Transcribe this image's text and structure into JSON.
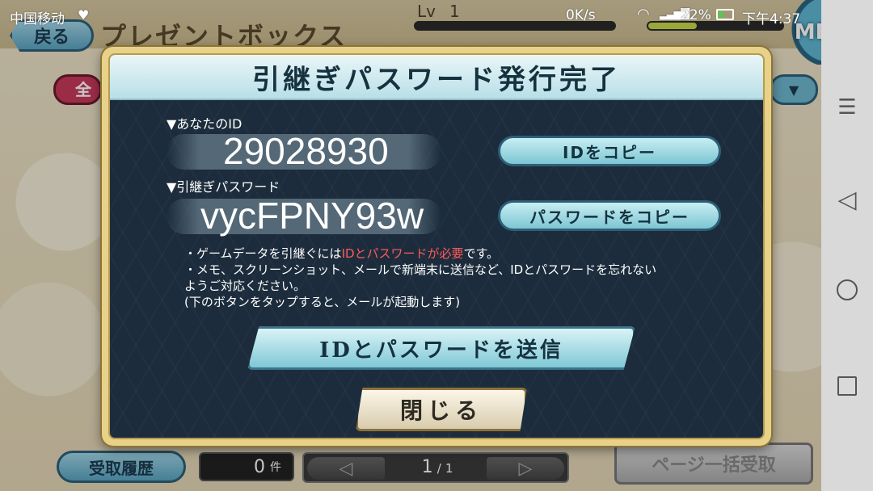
{
  "status_bar": {
    "carrier": "中国移动",
    "network_speed": "0K/s",
    "battery_percent": "22%",
    "time": "下午4:37",
    "icons": [
      "heart-icon",
      "wifi-icon",
      "signal-icon",
      "battery-icon"
    ]
  },
  "screen": {
    "back_label": "戻る",
    "title": "プレゼントボックス",
    "level_label": "Lv",
    "level_value": "1",
    "menu_label": "MENU",
    "filter_label": "全"
  },
  "dialog": {
    "title": "引継ぎパスワード発行完了",
    "id_label": "▼あなたのID",
    "id_value": "29028930",
    "id_copy_label": "IDをコピー",
    "password_label": "▼引継ぎパスワード",
    "password_value": "vycFPNY93w",
    "password_copy_label": "パスワードをコピー",
    "notes": {
      "line1_prefix": "・ゲームデータを引継ぐには",
      "line1_highlight": "IDとパスワードが必要",
      "line1_suffix": "です。",
      "line2": "・メモ、スクリーンショット、メールで新端末に送信など、IDとパスワードを忘れない",
      "line3": "ようご対応ください。",
      "line4": "(下のボタンをタップすると、メールが起動します)"
    },
    "send_label": "IDとパスワードを送信",
    "close_label": "閉じる"
  },
  "bottom_bar": {
    "history_label": "受取履歴",
    "count_value": "0",
    "count_unit": "件",
    "page_current": "1",
    "page_separator": "/",
    "page_total": "1",
    "receive_all_label": "ページ一括受取"
  },
  "colors": {
    "dialog_bg": "#1c2c3c",
    "dialog_frame": "#e8d28a",
    "button_blue": "#7cc6d3",
    "highlight_red": "#ff5a5a"
  }
}
